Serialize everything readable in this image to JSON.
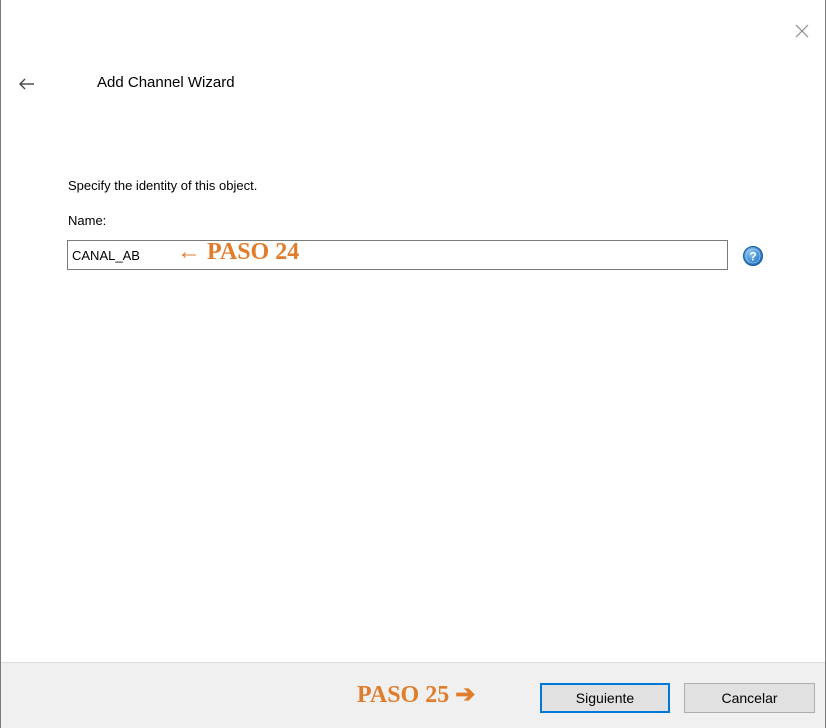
{
  "window": {
    "title": "Add Channel Wizard"
  },
  "form": {
    "instruction": "Specify the identity of this object.",
    "name_label": "Name:",
    "name_value": "CANAL_AB"
  },
  "annotations": {
    "step24": "← PASO 24",
    "step25": "PASO 25 ➔",
    "color": "#e07d2c"
  },
  "buttons": {
    "next_label": "Siguiente",
    "cancel_label": "Cancelar"
  },
  "icons": {
    "close": "close-icon",
    "back": "back-arrow-icon",
    "help": "help-icon"
  }
}
